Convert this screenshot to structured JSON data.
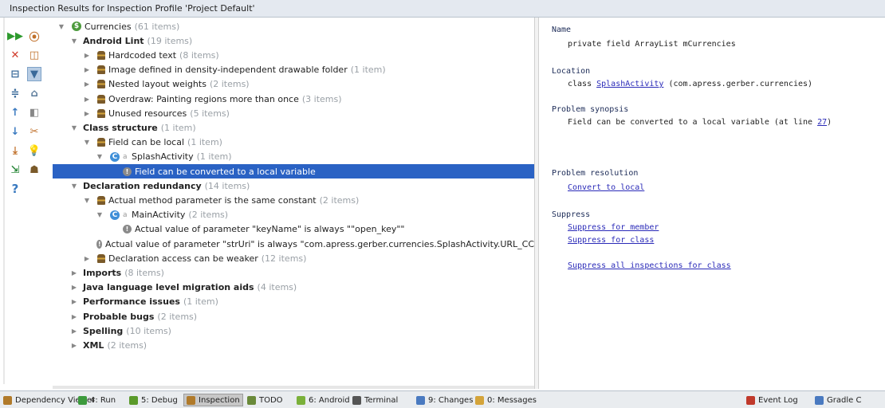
{
  "window": {
    "title": "Inspection Results for Inspection Profile 'Project Default'"
  },
  "toolbar": {
    "icons": [
      "run-icon",
      "rerun-icon",
      "close-icon",
      "filter-icon",
      "expand-all-icon",
      "group-icon",
      "collapse-all-icon",
      "settings-icon",
      "previous-icon",
      "autoscroll-icon",
      "next-icon",
      "suppress-icon",
      "export-icon",
      "quickfix-icon",
      "edit-source-icon",
      "inspection-icon",
      "help-icon"
    ],
    "help_label": "?"
  },
  "tree": {
    "rows": [
      {
        "depth": 0,
        "arrow": "▼",
        "icon": "currency",
        "label": "Currencies",
        "count": "(61 items)",
        "bold": false
      },
      {
        "depth": 1,
        "arrow": "▼",
        "icon": "none",
        "label": "Android Lint",
        "count": "(19 items)",
        "bold": true
      },
      {
        "depth": 2,
        "arrow": "▶",
        "icon": "hat",
        "label": "Hardcoded text",
        "count": "(8 items)",
        "bold": false
      },
      {
        "depth": 2,
        "arrow": "▶",
        "icon": "hat",
        "label": "Image defined in density-independent drawable folder",
        "count": "(1 item)",
        "bold": false
      },
      {
        "depth": 2,
        "arrow": "▶",
        "icon": "hat",
        "label": "Nested layout weights",
        "count": "(2 items)",
        "bold": false
      },
      {
        "depth": 2,
        "arrow": "▶",
        "icon": "hat",
        "label": "Overdraw: Painting regions more than once",
        "count": "(3 items)",
        "bold": false
      },
      {
        "depth": 2,
        "arrow": "▶",
        "icon": "hat",
        "label": "Unused resources",
        "count": "(5 items)",
        "bold": false
      },
      {
        "depth": 1,
        "arrow": "▼",
        "icon": "none",
        "label": "Class structure",
        "count": "(1 item)",
        "bold": true
      },
      {
        "depth": 2,
        "arrow": "▼",
        "icon": "hat",
        "label": "Field can be local",
        "count": "(1 item)",
        "bold": false
      },
      {
        "depth": 3,
        "arrow": "▼",
        "icon": "class",
        "label": "SplashActivity",
        "count": "(1 item)",
        "bold": false
      },
      {
        "depth": 4,
        "arrow": "",
        "icon": "warn",
        "label": "Field can be converted to a local variable",
        "count": "",
        "bold": false,
        "selected": true
      },
      {
        "depth": 1,
        "arrow": "▼",
        "icon": "none",
        "label": "Declaration redundancy",
        "count": "(14 items)",
        "bold": true
      },
      {
        "depth": 2,
        "arrow": "▼",
        "icon": "hat",
        "label": "Actual method parameter is the same constant",
        "count": "(2 items)",
        "bold": false
      },
      {
        "depth": 3,
        "arrow": "▼",
        "icon": "class",
        "label": "MainActivity",
        "count": "(2 items)",
        "bold": false
      },
      {
        "depth": 4,
        "arrow": "",
        "icon": "warn",
        "label": "Actual value of parameter \"keyName\" is always \"\"open_key\"\"",
        "count": "",
        "bold": false
      },
      {
        "depth": 4,
        "arrow": "",
        "icon": "warn",
        "label": "Actual value of parameter \"strUri\" is always \"com.apress.gerber.currencies.SplashActivity.URL_CC",
        "count": "",
        "bold": false
      },
      {
        "depth": 2,
        "arrow": "▶",
        "icon": "hat",
        "label": "Declaration access can be weaker",
        "count": "(12 items)",
        "bold": false
      },
      {
        "depth": 1,
        "arrow": "▶",
        "icon": "none",
        "label": "Imports",
        "count": "(8 items)",
        "bold": true
      },
      {
        "depth": 1,
        "arrow": "▶",
        "icon": "none",
        "label": "Java language level migration aids",
        "count": "(4 items)",
        "bold": true
      },
      {
        "depth": 1,
        "arrow": "▶",
        "icon": "none",
        "label": "Performance issues",
        "count": "(1 item)",
        "bold": true
      },
      {
        "depth": 1,
        "arrow": "▶",
        "icon": "none",
        "label": "Probable bugs",
        "count": "(2 items)",
        "bold": true
      },
      {
        "depth": 1,
        "arrow": "▶",
        "icon": "none",
        "label": "Spelling",
        "count": "(10 items)",
        "bold": true
      },
      {
        "depth": 1,
        "arrow": "▶",
        "icon": "none",
        "label": "XML",
        "count": "(2 items)",
        "bold": true
      }
    ]
  },
  "detail": {
    "name_head": "Name",
    "name_val": "private field ArrayList mCurrencies",
    "location_head": "Location",
    "location_prefix": "class ",
    "location_link": "SplashActivity",
    "location_suffix": " (com.apress.gerber.currencies)",
    "synopsis_head": "Problem synopsis",
    "synopsis_prefix": "Field can be converted to a local variable (at line ",
    "synopsis_link": "27",
    "synopsis_suffix": ")",
    "resolution_head": "Problem resolution",
    "resolution_link": "Convert to local",
    "suppress_head": "Suppress",
    "suppress_member": "Suppress for member",
    "suppress_class": "Suppress for class",
    "suppress_all": "Suppress all inspections for class"
  },
  "status_bar": {
    "items": [
      {
        "label": "Dependency Viewer",
        "icon": "dependency-icon",
        "color": "#b07a2a"
      },
      {
        "label": "4: Run",
        "icon": "run-icon",
        "color": "#3c9a3c"
      },
      {
        "label": "5: Debug",
        "icon": "debug-icon",
        "color": "#5a9a2a"
      },
      {
        "label": "Inspection",
        "icon": "inspection-icon",
        "color": "#b07a2a",
        "active": true
      },
      {
        "label": "TODO",
        "icon": "todo-icon",
        "color": "#6a8a3a"
      },
      {
        "label": "6: Android",
        "icon": "android-icon",
        "color": "#7ab03a"
      },
      {
        "label": "Terminal",
        "icon": "terminal-icon",
        "color": "#555555"
      },
      {
        "label": "9: Changes",
        "icon": "changes-icon",
        "color": "#4a7ac0"
      },
      {
        "label": "0: Messages",
        "icon": "messages-icon",
        "color": "#d4a43a"
      },
      {
        "label": "Event Log",
        "icon": "event-log-icon",
        "color": "#c0392b"
      },
      {
        "label": "Gradle C",
        "icon": "gradle-icon",
        "color": "#4a7ac0"
      }
    ]
  }
}
